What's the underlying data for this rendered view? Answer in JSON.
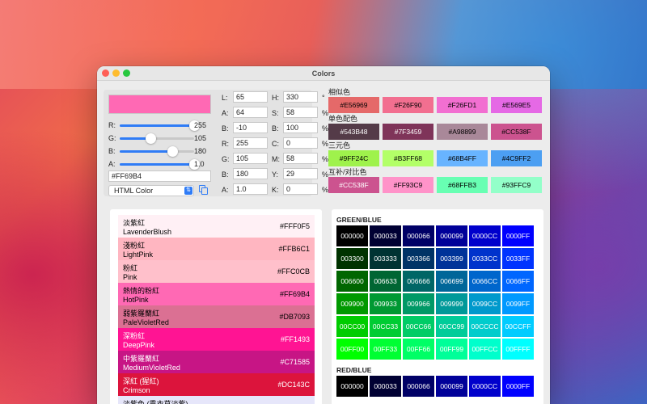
{
  "window": {
    "title": "Colors"
  },
  "current": {
    "color": "#FF69B4",
    "hex": "#FF69B4",
    "format": "HTML Color",
    "sliders": [
      {
        "label": "R:",
        "value": "255",
        "fraction": 1.0,
        "color": "#2f7cf6"
      },
      {
        "label": "G:",
        "value": "105",
        "fraction": 0.41,
        "color": "#2f7cf6"
      },
      {
        "label": "B:",
        "value": "180",
        "fraction": 0.71,
        "color": "#2f7cf6"
      },
      {
        "label": "A:",
        "value": "1.0",
        "fraction": 1.0,
        "color": "#2f7cf6"
      }
    ]
  },
  "fields_lab": [
    {
      "label": "L:",
      "value": "65",
      "unit": ""
    },
    {
      "label": "A:",
      "value": "64",
      "unit": ""
    },
    {
      "label": "B:",
      "value": "-10",
      "unit": ""
    },
    {
      "label": "R:",
      "value": "255",
      "unit": ""
    },
    {
      "label": "G:",
      "value": "105",
      "unit": ""
    },
    {
      "label": "B:",
      "value": "180",
      "unit": ""
    },
    {
      "label": "A:",
      "value": "1.0",
      "unit": ""
    }
  ],
  "fields_hsb": [
    {
      "label": "H:",
      "value": "330",
      "unit": "°"
    },
    {
      "label": "S:",
      "value": "58",
      "unit": "%"
    },
    {
      "label": "B:",
      "value": "100",
      "unit": "%"
    },
    {
      "label": "C:",
      "value": "0",
      "unit": "%"
    },
    {
      "label": "M:",
      "value": "58",
      "unit": "%"
    },
    {
      "label": "Y:",
      "value": "29",
      "unit": "%"
    },
    {
      "label": "K:",
      "value": "0",
      "unit": "%"
    }
  ],
  "palettes": [
    {
      "title": "相似色",
      "swatches": [
        {
          "hex": "#E56969",
          "text": "#000"
        },
        {
          "hex": "#F26F90",
          "text": "#000"
        },
        {
          "hex": "#F26FD1",
          "text": "#000"
        },
        {
          "hex": "#E569E5",
          "text": "#000"
        }
      ]
    },
    {
      "title": "单色配色",
      "swatches": [
        {
          "hex": "#543B48",
          "text": "#fff"
        },
        {
          "hex": "#7F3459",
          "text": "#fff"
        },
        {
          "hex": "#A98899",
          "text": "#000"
        },
        {
          "hex": "#CC538F",
          "text": "#000"
        }
      ]
    },
    {
      "title": "三元色",
      "swatches": [
        {
          "hex": "#9FF24C",
          "text": "#000"
        },
        {
          "hex": "#B3FF68",
          "text": "#000"
        },
        {
          "hex": "#68B4FF",
          "text": "#000"
        },
        {
          "hex": "#4C9FF2",
          "text": "#000"
        }
      ]
    },
    {
      "title": "互补/对比色",
      "swatches": [
        {
          "hex": "#CC538F",
          "text": "#fff"
        },
        {
          "hex": "#FF93C9",
          "text": "#000"
        },
        {
          "hex": "#68FFB3",
          "text": "#000"
        },
        {
          "hex": "#93FFC9",
          "text": "#000"
        }
      ]
    }
  ],
  "named_colors": [
    {
      "cn": "淡紫紅",
      "en": "LavenderBlush",
      "hex": "#FFF0F5",
      "text": "#000"
    },
    {
      "cn": "淺粉紅",
      "en": "LightPink",
      "hex": "#FFB6C1",
      "text": "#000"
    },
    {
      "cn": "粉紅",
      "en": "Pink",
      "hex": "#FFC0CB",
      "text": "#000"
    },
    {
      "cn": "熱情的粉紅",
      "en": "HotPink",
      "hex": "#FF69B4",
      "text": "#000"
    },
    {
      "cn": "弱紫羅蘭紅",
      "en": "PaleVioletRed",
      "hex": "#DB7093",
      "text": "#000"
    },
    {
      "cn": "深粉紅",
      "en": "DeepPink",
      "hex": "#FF1493",
      "text": "#fff"
    },
    {
      "cn": "中紫羅蘭紅",
      "en": "MediumVioletRed",
      "hex": "#C71585",
      "text": "#fff"
    },
    {
      "cn": "深紅 (猩紅)",
      "en": "Crimson",
      "hex": "#DC143C",
      "text": "#fff"
    },
    {
      "cn": "淡紫色 (熏衣草淡紫)",
      "en": "",
      "hex": "",
      "text": "#000",
      "color": "#E6E6FA"
    }
  ],
  "grids": [
    {
      "title": "GREEN/BLUE",
      "rows": [
        [
          "000000",
          "000033",
          "000066",
          "000099",
          "0000CC",
          "0000FF"
        ],
        [
          "003300",
          "003333",
          "003366",
          "003399",
          "0033CC",
          "0033FF"
        ],
        [
          "006600",
          "006633",
          "006666",
          "006699",
          "0066CC",
          "0066FF"
        ],
        [
          "009900",
          "009933",
          "009966",
          "009999",
          "0099CC",
          "0099FF"
        ],
        [
          "00CC00",
          "00CC33",
          "00CC66",
          "00CC99",
          "00CCCC",
          "00CCFF"
        ],
        [
          "00FF00",
          "00FF33",
          "00FF66",
          "00FF99",
          "00FFCC",
          "00FFFF"
        ]
      ]
    },
    {
      "title": "RED/BLUE",
      "rows": [
        [
          "000000",
          "000033",
          "000066",
          "000099",
          "0000CC",
          "0000FF"
        ]
      ]
    }
  ]
}
